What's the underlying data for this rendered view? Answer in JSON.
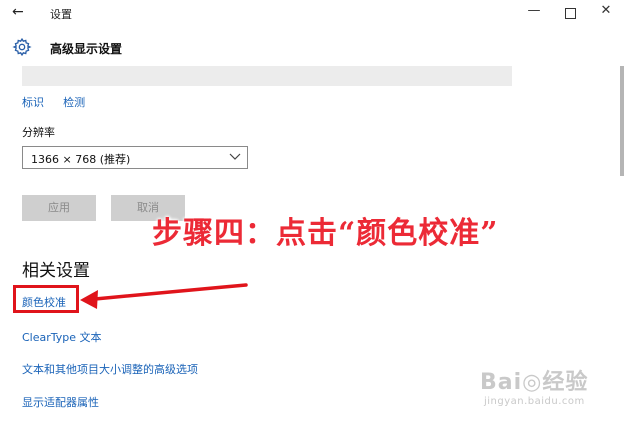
{
  "window": {
    "back_glyph": "←",
    "title": "设置",
    "min_glyph": "—",
    "close_glyph": "✕"
  },
  "header": {
    "icon": "gear-icon",
    "title": "高级显示设置"
  },
  "identify_links": [
    "标识",
    "检测"
  ],
  "resolution": {
    "label": "分辨率",
    "value": "1366 × 768 (推荐)"
  },
  "buttons": {
    "apply": "应用",
    "cancel": "取消"
  },
  "related": {
    "title": "相关设置",
    "links": [
      "颜色校准",
      "ClearType 文本",
      "文本和其他项目大小调整的高级选项",
      "显示适配器属性"
    ]
  },
  "annotation": {
    "text": "步骤四：点击“颜色校准”",
    "color": "#ec2a36"
  },
  "watermark": {
    "main": "Bai◎经验",
    "sub": "jingyan.baidu.com"
  },
  "colors": {
    "link": "#1a63b8",
    "highlight": "#e0141b"
  }
}
